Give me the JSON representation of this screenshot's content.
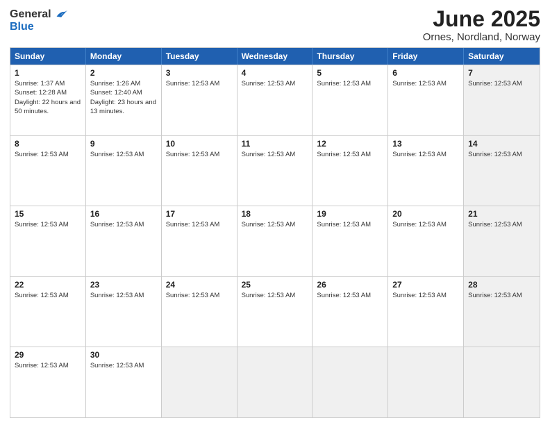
{
  "header": {
    "logo_general": "General",
    "logo_blue": "Blue",
    "main_title": "June 2025",
    "subtitle": "Ornes, Nordland, Norway"
  },
  "calendar": {
    "days_of_week": [
      "Sunday",
      "Monday",
      "Tuesday",
      "Wednesday",
      "Thursday",
      "Friday",
      "Saturday"
    ],
    "rows": [
      [
        {
          "day": "1",
          "info": "Sunrise: 1:37 AM\nSunset: 12:28 AM\nDaylight: 22 hours and 50 minutes.",
          "shaded": false
        },
        {
          "day": "2",
          "info": "Sunrise: 1:26 AM\nSunset: 12:40 AM\nDaylight: 23 hours and 13 minutes.",
          "shaded": false
        },
        {
          "day": "3",
          "info": "Sunrise: 12:53 AM",
          "shaded": false
        },
        {
          "day": "4",
          "info": "Sunrise: 12:53 AM",
          "shaded": false
        },
        {
          "day": "5",
          "info": "Sunrise: 12:53 AM",
          "shaded": false
        },
        {
          "day": "6",
          "info": "Sunrise: 12:53 AM",
          "shaded": false
        },
        {
          "day": "7",
          "info": "Sunrise: 12:53 AM",
          "shaded": true
        }
      ],
      [
        {
          "day": "8",
          "info": "Sunrise: 12:53 AM",
          "shaded": false
        },
        {
          "day": "9",
          "info": "Sunrise: 12:53 AM",
          "shaded": false
        },
        {
          "day": "10",
          "info": "Sunrise: 12:53 AM",
          "shaded": false
        },
        {
          "day": "11",
          "info": "Sunrise: 12:53 AM",
          "shaded": false
        },
        {
          "day": "12",
          "info": "Sunrise: 12:53 AM",
          "shaded": false
        },
        {
          "day": "13",
          "info": "Sunrise: 12:53 AM",
          "shaded": false
        },
        {
          "day": "14",
          "info": "Sunrise: 12:53 AM",
          "shaded": true
        }
      ],
      [
        {
          "day": "15",
          "info": "Sunrise: 12:53 AM",
          "shaded": false
        },
        {
          "day": "16",
          "info": "Sunrise: 12:53 AM",
          "shaded": false
        },
        {
          "day": "17",
          "info": "Sunrise: 12:53 AM",
          "shaded": false
        },
        {
          "day": "18",
          "info": "Sunrise: 12:53 AM",
          "shaded": false
        },
        {
          "day": "19",
          "info": "Sunrise: 12:53 AM",
          "shaded": false
        },
        {
          "day": "20",
          "info": "Sunrise: 12:53 AM",
          "shaded": false
        },
        {
          "day": "21",
          "info": "Sunrise: 12:53 AM",
          "shaded": true
        }
      ],
      [
        {
          "day": "22",
          "info": "Sunrise: 12:53 AM",
          "shaded": false
        },
        {
          "day": "23",
          "info": "Sunrise: 12:53 AM",
          "shaded": false
        },
        {
          "day": "24",
          "info": "Sunrise: 12:53 AM",
          "shaded": false
        },
        {
          "day": "25",
          "info": "Sunrise: 12:53 AM",
          "shaded": false
        },
        {
          "day": "26",
          "info": "Sunrise: 12:53 AM",
          "shaded": false
        },
        {
          "day": "27",
          "info": "Sunrise: 12:53 AM",
          "shaded": false
        },
        {
          "day": "28",
          "info": "Sunrise: 12:53 AM",
          "shaded": true
        }
      ],
      [
        {
          "day": "29",
          "info": "Sunrise: 12:53 AM",
          "shaded": false
        },
        {
          "day": "30",
          "info": "Sunrise: 12:53 AM",
          "shaded": false
        },
        {
          "day": "",
          "info": "",
          "shaded": true
        },
        {
          "day": "",
          "info": "",
          "shaded": true
        },
        {
          "day": "",
          "info": "",
          "shaded": true
        },
        {
          "day": "",
          "info": "",
          "shaded": true
        },
        {
          "day": "",
          "info": "",
          "shaded": true
        }
      ]
    ]
  }
}
